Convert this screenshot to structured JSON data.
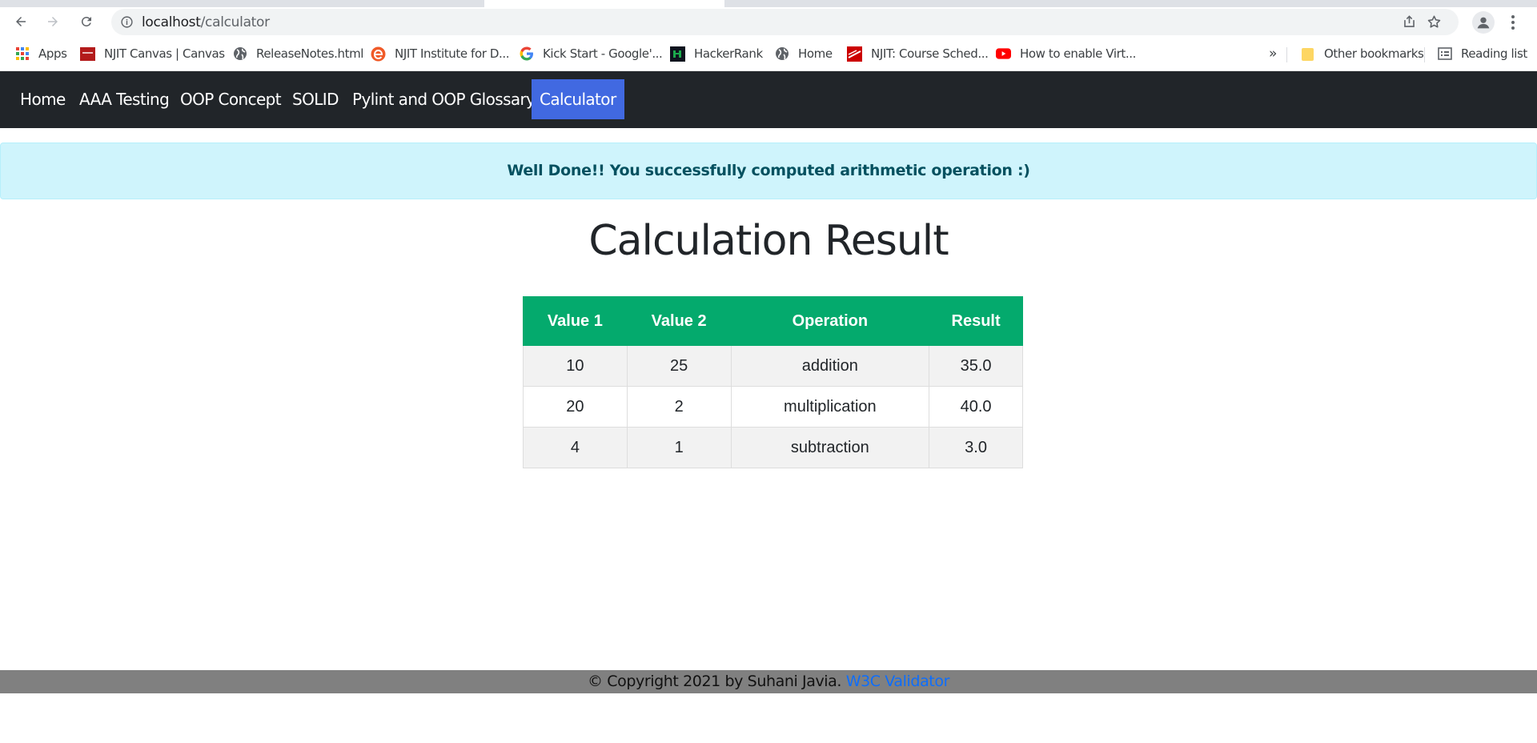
{
  "browser": {
    "url_host": "localhost",
    "url_path": "/calculator",
    "bookmarks": [
      {
        "label": "Apps",
        "icon": "apps-grid-icon"
      },
      {
        "label": "NJIT Canvas | Canvas",
        "icon": "njit-canvas-icon"
      },
      {
        "label": "ReleaseNotes.html",
        "icon": "globe-icon"
      },
      {
        "label": "NJIT Institute for D...",
        "icon": "e-logo-icon"
      },
      {
        "label": "Kick Start - Google'...",
        "icon": "google-icon"
      },
      {
        "label": "HackerRank",
        "icon": "hackerrank-icon"
      },
      {
        "label": "Home",
        "icon": "globe-icon"
      },
      {
        "label": "NJIT: Course Sched...",
        "icon": "njit-icon"
      },
      {
        "label": "How to enable Virt...",
        "icon": "youtube-icon"
      }
    ],
    "overflow_label": "»",
    "other_bookmarks": "Other bookmarks",
    "reading_list": "Reading list"
  },
  "nav": {
    "links": [
      "Home",
      "AAA Testing",
      "OOP Concept",
      "SOLID",
      "Pylint and OOP Glossary",
      "Calculator"
    ],
    "active": "Calculator",
    "bg_color": "#212529",
    "active_color": "#4169e1"
  },
  "alert": {
    "message": "Well Done!! You successfully computed arithmetic operation :)"
  },
  "page": {
    "title": "Calculation Result"
  },
  "table": {
    "headers": [
      "Value 1",
      "Value 2",
      "Operation",
      "Result"
    ],
    "header_color": "#04aa6d",
    "rows": [
      [
        "10",
        "25",
        "addition",
        "35.0"
      ],
      [
        "20",
        "2",
        "multiplication",
        "40.0"
      ],
      [
        "4",
        "1",
        "subtraction",
        "3.0"
      ]
    ]
  },
  "footer": {
    "copyright": "© Copyright 2021 by Suhani Javia.",
    "link": "W3C Validator"
  }
}
